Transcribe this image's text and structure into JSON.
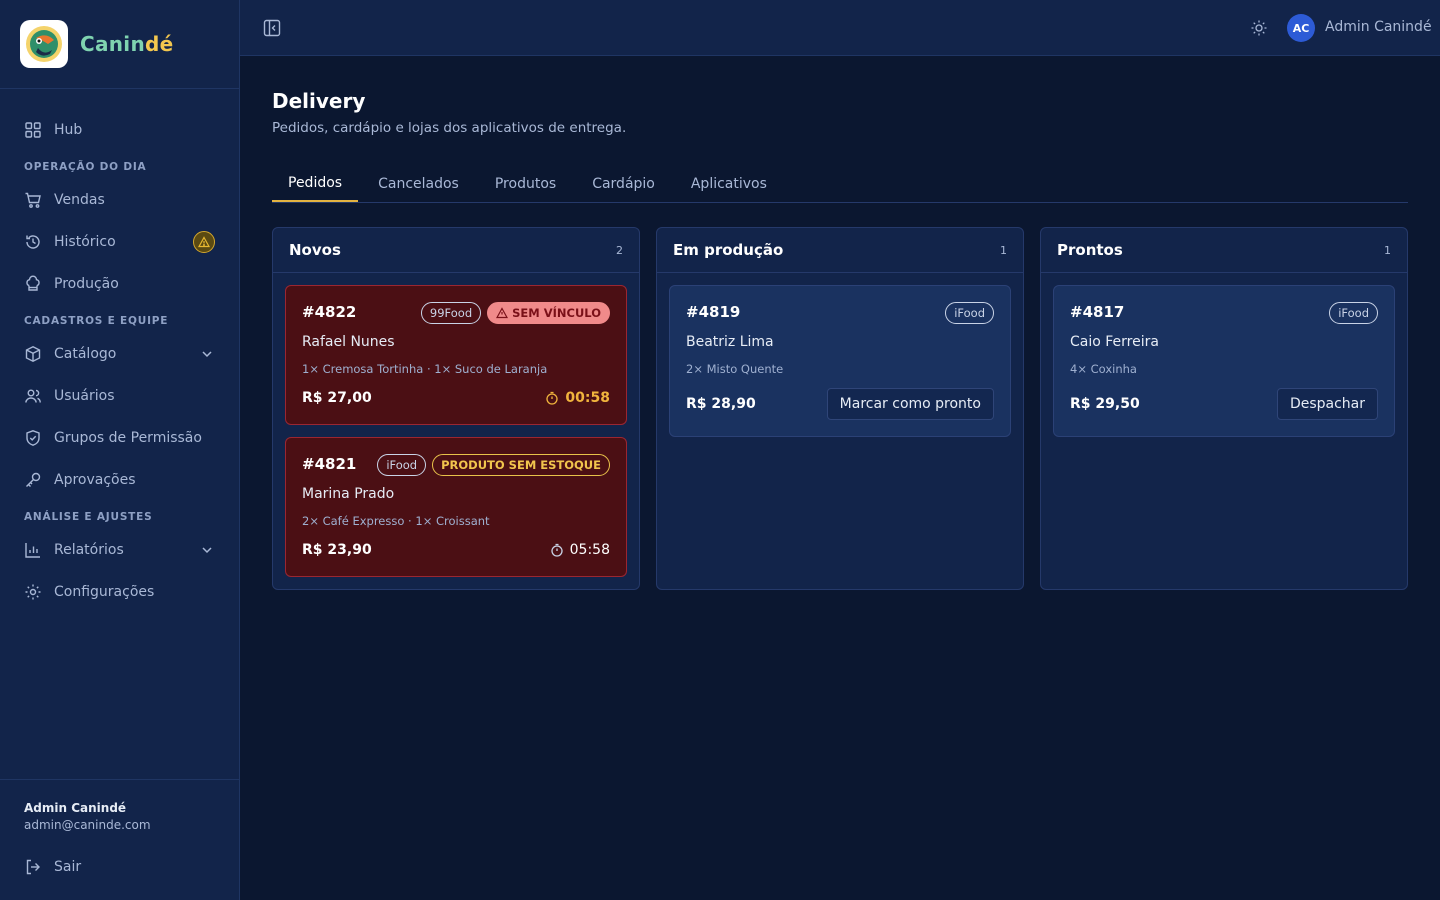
{
  "brand": {
    "name_part1": "Canin",
    "name_part2": "dé"
  },
  "sidebar": {
    "hub": "Hub",
    "section1": "OPERAÇÃO DO DIA",
    "vendas": "Vendas",
    "historico": "Histórico",
    "producao": "Produção",
    "section2": "CADASTROS E EQUIPE",
    "catalogo": "Catálogo",
    "usuarios": "Usuários",
    "grupos": "Grupos de Permissão",
    "aprovacoes": "Aprovações",
    "section3": "ANÁLISE E AJUSTES",
    "relatorios": "Relatórios",
    "configuracoes": "Configurações",
    "user_name": "Admin Canindé",
    "user_email": "admin@caninde.com",
    "logout": "Sair"
  },
  "topbar": {
    "avatar_initials": "AC",
    "user_name": "Admin Canindé"
  },
  "page": {
    "title": "Delivery",
    "subtitle": "Pedidos, cardápio e lojas dos aplicativos de entrega."
  },
  "tabs": [
    "Pedidos",
    "Cancelados",
    "Produtos",
    "Cardápio",
    "Aplicativos"
  ],
  "columns": {
    "novos": {
      "title": "Novos",
      "count": "2",
      "cards": [
        {
          "id": "#4822",
          "platform": "99Food",
          "flag": "SEM VÍNCULO",
          "customer": "Rafael Nunes",
          "items": "1× Cremosa Tortinha · 1× Suco de Laranja",
          "price": "R$ 27,00",
          "timer": "00:58"
        },
        {
          "id": "#4821",
          "platform": "iFood",
          "flag": "PRODUTO SEM ESTOQUE",
          "customer": "Marina Prado",
          "items": "2× Café Expresso · 1× Croissant",
          "price": "R$ 23,90",
          "timer": "05:58"
        }
      ]
    },
    "producao": {
      "title": "Em produção",
      "count": "1",
      "cards": [
        {
          "id": "#4819",
          "platform": "iFood",
          "customer": "Beatriz Lima",
          "items": "2× Misto Quente",
          "price": "R$ 28,90",
          "action": "Marcar como pronto"
        }
      ]
    },
    "prontos": {
      "title": "Prontos",
      "count": "1",
      "cards": [
        {
          "id": "#4817",
          "platform": "iFood",
          "customer": "Caio Ferreira",
          "items": "4× Coxinha",
          "price": "R$ 29,50",
          "action": "Despachar"
        }
      ]
    }
  },
  "colors": {
    "background": "#0b1730",
    "panel": "#12244a",
    "accent": "#e3b341",
    "alert_card": "#4b0f14",
    "brand_green": "#7fd3b0"
  }
}
